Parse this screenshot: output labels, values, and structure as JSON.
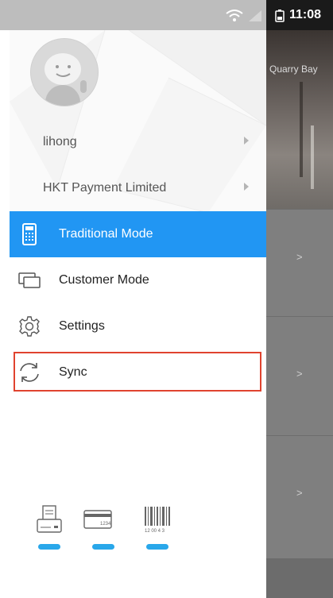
{
  "status_bar": {
    "time": "11:08"
  },
  "background_app": {
    "location_label": "Quarry Bay",
    "row_arrow": ">"
  },
  "drawer": {
    "user_name": "lihong",
    "merchant_name": "HKT Payment Limited",
    "menu": [
      {
        "label": "Traditional Mode",
        "icon": "calculator-icon",
        "active": true
      },
      {
        "label": "Customer Mode",
        "icon": "screens-icon",
        "active": false
      },
      {
        "label": "Settings",
        "icon": "gear-icon",
        "active": false
      },
      {
        "label": "Sync",
        "icon": "sync-icon",
        "active": false
      }
    ],
    "bottom_icons": [
      "printer-icon",
      "card-icon",
      "barcode-icon"
    ],
    "card_number_text": "1234",
    "barcode_text": "12 00 4 3"
  },
  "colors": {
    "accent": "#2196f3",
    "highlight_border": "#e0432f",
    "indicator": "#29a7ea"
  }
}
